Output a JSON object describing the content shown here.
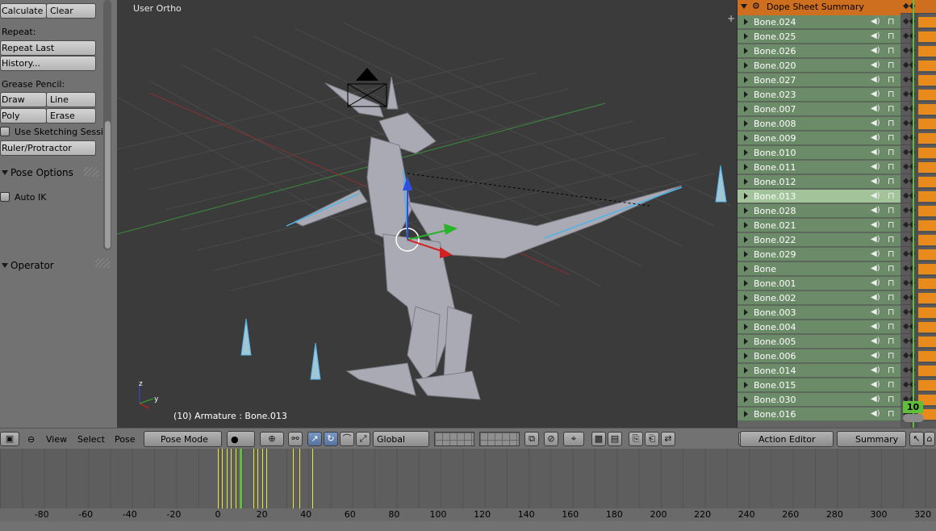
{
  "tool_panel": {
    "calculate": "Calculate",
    "clear": "Clear",
    "repeat_heading": "Repeat:",
    "repeat_last": "Repeat Last",
    "history": "History...",
    "grease_heading": "Grease Pencil:",
    "draw": "Draw",
    "line": "Line",
    "poly": "Poly",
    "erase": "Erase",
    "use_sketching": "Use Sketching Sessi",
    "ruler": "Ruler/Protractor",
    "pose_options": "Pose Options",
    "auto_ik": "Auto IK",
    "operator": "Operator"
  },
  "viewport": {
    "label": "User Ortho",
    "object_info": "(10) Armature : Bone.013",
    "axes": {
      "x": "y",
      "z": "z"
    }
  },
  "view_header": {
    "view": "View",
    "select": "Select",
    "pose": "Pose",
    "mode": "Pose Mode",
    "orientation": "Global"
  },
  "dope_sheet": {
    "summary": "Dope Sheet Summary",
    "current_frame": "10",
    "selected_bone": "Bone.013",
    "bones": [
      "Bone.024",
      "Bone.025",
      "Bone.026",
      "Bone.020",
      "Bone.027",
      "Bone.023",
      "Bone.007",
      "Bone.008",
      "Bone.009",
      "Bone.010",
      "Bone.011",
      "Bone.012",
      "Bone.013",
      "Bone.028",
      "Bone.021",
      "Bone.022",
      "Bone.029",
      "Bone",
      "Bone.001",
      "Bone.002",
      "Bone.003",
      "Bone.004",
      "Bone.005",
      "Bone.006",
      "Bone.014",
      "Bone.015",
      "Bone.030",
      "Bone.016"
    ],
    "header_mode": "Action Editor",
    "header_view": "Summary"
  },
  "timeline": {
    "ticks": [
      "-80",
      "-60",
      "-40",
      "-20",
      "0",
      "20",
      "40",
      "60",
      "80",
      "100",
      "120",
      "140",
      "160",
      "180",
      "200",
      "220",
      "240",
      "260",
      "280",
      "300",
      "320"
    ]
  },
  "colors": {
    "summary_orange": "#cd6f1f",
    "bone_row_green": "#6c8b68",
    "selected_bone_green": "#a3c39a",
    "keyframe_yellow": "#e6e83a",
    "current_frame_green": "#5fbf3a"
  }
}
